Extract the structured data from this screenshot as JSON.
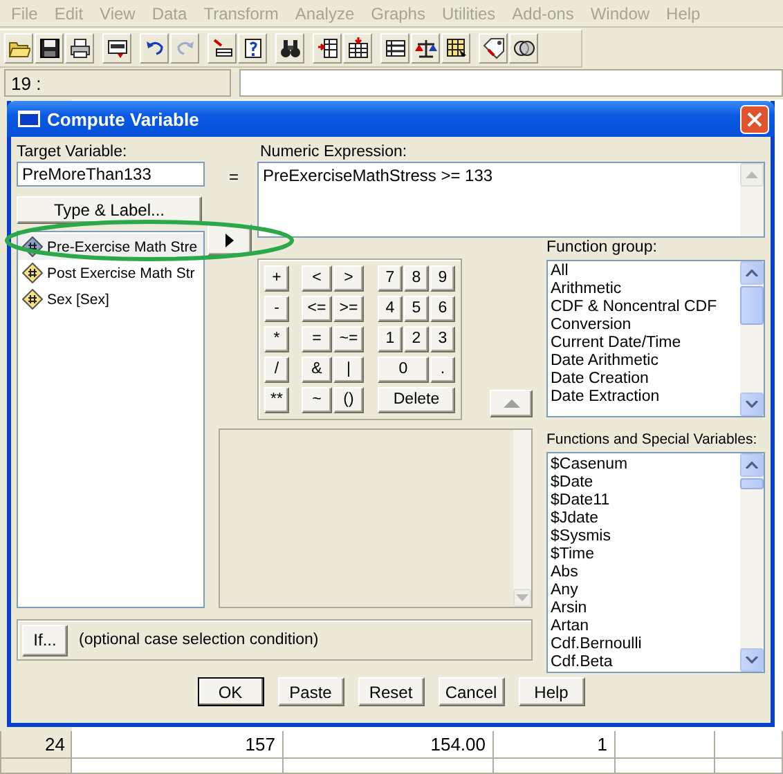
{
  "menu": [
    {
      "label": "File",
      "disabled": true
    },
    {
      "label": "Edit",
      "disabled": true
    },
    {
      "label": "View",
      "disabled": true
    },
    {
      "label": "Data",
      "disabled": true
    },
    {
      "label": "Transform",
      "disabled": true
    },
    {
      "label": "Analyze",
      "disabled": true
    },
    {
      "label": "Graphs",
      "disabled": true
    },
    {
      "label": "Utilities",
      "disabled": true
    },
    {
      "label": "Add-ons",
      "disabled": true
    },
    {
      "label": "Window",
      "disabled": true
    },
    {
      "label": "Help",
      "disabled": true
    }
  ],
  "toolbar": [
    [
      {
        "kind": "folder",
        "disabled": false
      },
      {
        "kind": "floppy",
        "disabled": false
      },
      {
        "kind": "printer",
        "disabled": false
      }
    ],
    [
      {
        "kind": "dialog",
        "disabled": false
      }
    ],
    [
      {
        "kind": "undo",
        "disabled": false
      },
      {
        "kind": "redo",
        "disabled": true
      }
    ],
    [
      {
        "kind": "goto",
        "disabled": false
      },
      {
        "kind": "varinfo",
        "disabled": false
      }
    ],
    [
      {
        "kind": "binoculars",
        "disabled": false
      }
    ],
    [
      {
        "kind": "insertcase",
        "disabled": false
      },
      {
        "kind": "insertvar",
        "disabled": false
      }
    ],
    [
      {
        "kind": "split",
        "disabled": false
      },
      {
        "kind": "scale",
        "disabled": false
      },
      {
        "kind": "select",
        "disabled": false
      }
    ],
    [
      {
        "kind": "tag",
        "disabled": false
      },
      {
        "kind": "circles",
        "disabled": false
      }
    ]
  ],
  "cell_editor": {
    "cell": "19 :"
  },
  "grid_rows": [
    {
      "row": "24",
      "cells": [
        "157",
        "154.00",
        "1"
      ]
    }
  ],
  "dialog": {
    "title": "Compute Variable",
    "target_variable": {
      "label": "Target Variable:",
      "value": "PreMoreThan133"
    },
    "equals": "=",
    "type_label_button": "Type & Label...",
    "variables": [
      {
        "name": "Pre-Exercise Math Stre",
        "selected": true
      },
      {
        "name": "Post Exercise Math Str",
        "selected": false
      },
      {
        "name": "Sex [Sex]",
        "selected": false
      }
    ],
    "expression": {
      "label": "Numeric Expression:",
      "value": "PreExerciseMathStress >= 133"
    },
    "keypad": [
      [
        "+",
        "<",
        ">",
        "7",
        "8",
        "9"
      ],
      [
        "-",
        "<=",
        ">=",
        "4",
        "5",
        "6"
      ],
      [
        "*",
        "=",
        "~=",
        "1",
        "2",
        "3"
      ],
      [
        "/",
        "&",
        "|",
        "0",
        "."
      ],
      [
        "**",
        "~",
        "()",
        "Delete"
      ]
    ],
    "function_group": {
      "label": "Function group:",
      "items": [
        "All",
        "Arithmetic",
        "CDF & Noncentral CDF",
        "Conversion",
        "Current Date/Time",
        "Date Arithmetic",
        "Date Creation",
        "Date Extraction"
      ]
    },
    "functions": {
      "label": "Functions and Special Variables:",
      "items": [
        "$Casenum",
        "$Date",
        "$Date11",
        "$Jdate",
        "$Sysmis",
        "$Time",
        "Abs",
        "Any",
        "Arsin",
        "Artan",
        "Cdf.Bernoulli",
        "Cdf.Beta"
      ]
    },
    "if_button": "If...",
    "if_condition": "(optional case selection condition)",
    "buttons": [
      {
        "label": "OK",
        "default": true
      },
      {
        "label": "Paste",
        "default": false
      },
      {
        "label": "Reset",
        "default": false
      },
      {
        "label": "Cancel",
        "default": false
      },
      {
        "label": "Help",
        "default": false
      }
    ]
  }
}
